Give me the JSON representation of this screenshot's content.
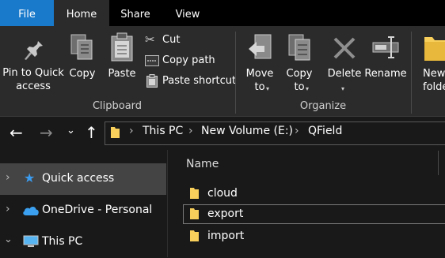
{
  "ribbon_tabs": [
    "File",
    "Home",
    "Share",
    "View"
  ],
  "clipboard": {
    "pin_to_quick_access": [
      "Pin to Quick",
      "access"
    ],
    "copy": "Copy",
    "paste": "Paste",
    "cut": "Cut",
    "copy_path": "Copy path",
    "paste_shortcut": "Paste shortcut",
    "group_label": "Clipboard"
  },
  "organize": {
    "move_to": "Move to",
    "copy_to": "Copy to",
    "delete": "Delete",
    "rename": "Rename",
    "group_label": "Organize"
  },
  "new_group": {
    "new_folder": [
      "New",
      "folde"
    ]
  },
  "address_bar": {
    "breadcrumbs": [
      "This PC",
      "New Volume (E:)",
      "QField"
    ]
  },
  "navigation_pane": {
    "items": [
      {
        "label": "Quick access",
        "icon": "star-icon",
        "selected": true
      },
      {
        "label": "OneDrive - Personal",
        "icon": "cloud-icon",
        "selected": false
      },
      {
        "label": "This PC",
        "icon": "computer-icon",
        "selected": false
      }
    ]
  },
  "file_list": {
    "column_name": "Name",
    "items": [
      "cloud",
      "export",
      "import"
    ]
  },
  "colors": {
    "accent": "#1979ca",
    "folder": "#f8cf5a",
    "background": "#191919",
    "ribbon": "#2b2b2b"
  }
}
